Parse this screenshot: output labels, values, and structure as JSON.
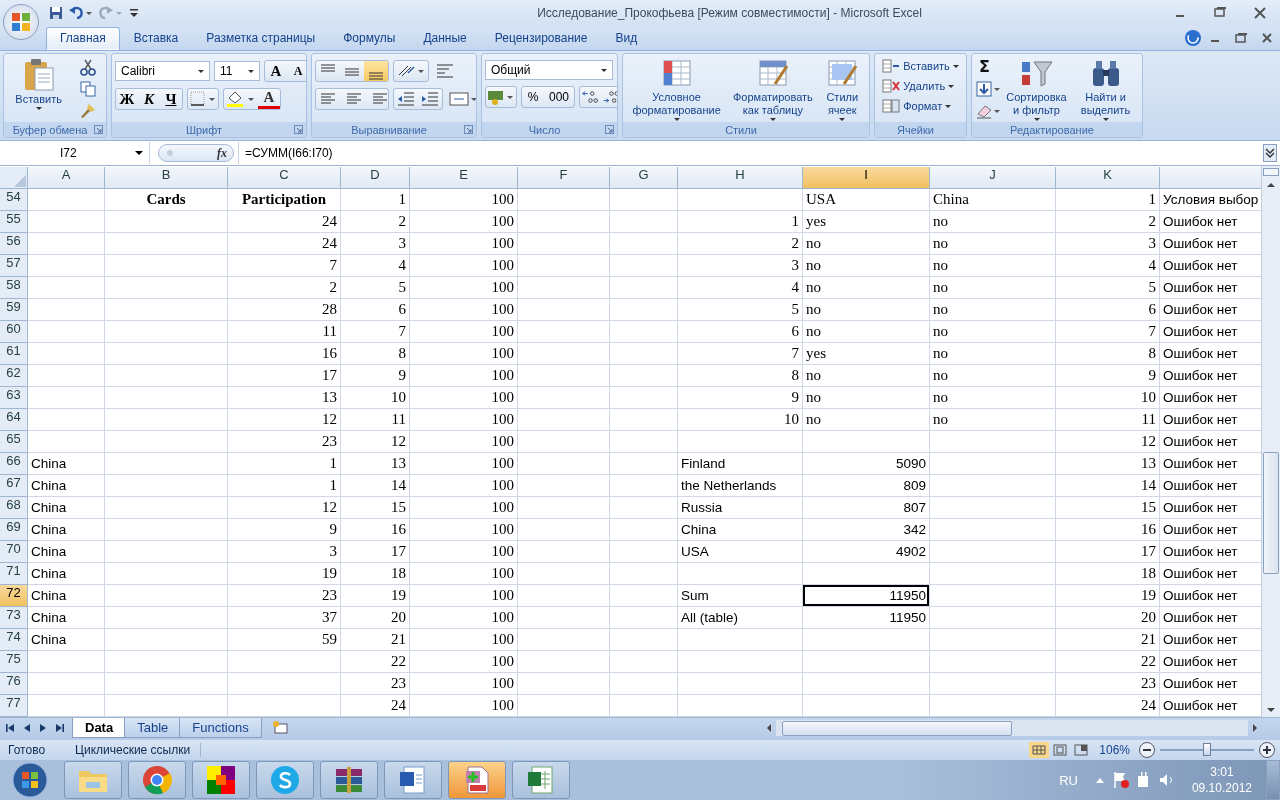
{
  "window": {
    "title": "Исследование_Прокофьева  [Режим совместимости] - Microsoft Excel"
  },
  "tabs": [
    {
      "label": "Главная",
      "selected": true
    },
    {
      "label": "Вставка",
      "selected": false
    },
    {
      "label": "Разметка страницы",
      "selected": false
    },
    {
      "label": "Формулы",
      "selected": false
    },
    {
      "label": "Данные",
      "selected": false
    },
    {
      "label": "Рецензирование",
      "selected": false
    },
    {
      "label": "Вид",
      "selected": false
    }
  ],
  "ribbon": {
    "groups": [
      {
        "kind": "clipboard",
        "label": "Буфер обмена",
        "paste": "Вставить"
      },
      {
        "kind": "font",
        "label": "Шрифт",
        "font": "Calibri",
        "size": "11",
        "grow": "A",
        "shrink": "A",
        "bold": "Ж",
        "italic": "К",
        "underline": "Ч",
        "color_letter": "A"
      },
      {
        "kind": "alignment",
        "label": "Выравнивание",
        "valign": [
          {
            "selected": false
          },
          {
            "selected": false
          },
          {
            "selected": true
          }
        ]
      },
      {
        "kind": "number",
        "label": "Число",
        "format": "Общий",
        "percent": "%",
        "thousands": "000"
      },
      {
        "kind": "styles",
        "label": "Стили",
        "buttons": [
          "Условное форматирование",
          "Форматировать как таблицу",
          "Стили ячеек"
        ]
      },
      {
        "kind": "cells",
        "label": "Ячейки",
        "buttons": [
          "Вставить",
          "Удалить",
          "Формат"
        ]
      },
      {
        "kind": "editing",
        "label": "Редактирование",
        "sum": "Σ",
        "buttons": [
          "Сортировка и фильтр",
          "Найти и выделить"
        ]
      }
    ]
  },
  "formula_bar": {
    "name_box": "I72",
    "fx": "fx",
    "formula": "=СУММ(I66:I70)"
  },
  "columns": [
    {
      "label": "A",
      "selected": false
    },
    {
      "label": "B",
      "selected": false
    },
    {
      "label": "C",
      "selected": false
    },
    {
      "label": "D",
      "selected": false
    },
    {
      "label": "E",
      "selected": false
    },
    {
      "label": "F",
      "selected": false
    },
    {
      "label": "G",
      "selected": false
    },
    {
      "label": "H",
      "selected": false
    },
    {
      "label": "I",
      "selected": true
    },
    {
      "label": "J",
      "selected": false
    },
    {
      "label": "K",
      "selected": false
    }
  ],
  "rows": [
    {
      "num": "54",
      "selected": false,
      "cells": [
        "",
        {
          "text": "Cards",
          "bold": true
        },
        {
          "text": "Participation",
          "bold": true
        },
        "1",
        "100",
        "",
        "",
        "",
        "USA",
        "China",
        "1",
        "Условия выбор"
      ]
    },
    {
      "num": "55",
      "selected": false,
      "cells": [
        "",
        "",
        "24",
        "2",
        "100",
        "",
        "",
        "1",
        "yes",
        "no",
        "2",
        "Ошибок нет"
      ]
    },
    {
      "num": "56",
      "selected": false,
      "cells": [
        "",
        "",
        "24",
        "3",
        "100",
        "",
        "",
        "2",
        "no",
        "no",
        "3",
        "Ошибок нет"
      ]
    },
    {
      "num": "57",
      "selected": false,
      "cells": [
        "",
        "",
        "7",
        "4",
        "100",
        "",
        "",
        "3",
        "no",
        "no",
        "4",
        "Ошибок нет"
      ]
    },
    {
      "num": "58",
      "selected": false,
      "cells": [
        "",
        "",
        "2",
        "5",
        "100",
        "",
        "",
        "4",
        "no",
        "no",
        "5",
        "Ошибок нет"
      ]
    },
    {
      "num": "59",
      "selected": false,
      "cells": [
        "",
        "",
        "28",
        "6",
        "100",
        "",
        "",
        "5",
        "no",
        "no",
        "6",
        "Ошибок нет"
      ]
    },
    {
      "num": "60",
      "selected": false,
      "cells": [
        "",
        "",
        "11",
        "7",
        "100",
        "",
        "",
        "6",
        "no",
        "no",
        "7",
        "Ошибок нет"
      ]
    },
    {
      "num": "61",
      "selected": false,
      "cells": [
        "",
        "",
        "16",
        "8",
        "100",
        "",
        "",
        "7",
        "yes",
        "no",
        "8",
        "Ошибок нет"
      ]
    },
    {
      "num": "62",
      "selected": false,
      "cells": [
        "",
        "",
        "17",
        "9",
        "100",
        "",
        "",
        "8",
        "no",
        "no",
        "9",
        "Ошибок нет"
      ]
    },
    {
      "num": "63",
      "selected": false,
      "cells": [
        "",
        "",
        "13",
        "10",
        "100",
        "",
        "",
        "9",
        "no",
        "no",
        "10",
        "Ошибок нет"
      ]
    },
    {
      "num": "64",
      "selected": false,
      "cells": [
        "",
        "",
        "12",
        "11",
        "100",
        "",
        "",
        "10",
        "no",
        "no",
        "11",
        "Ошибок нет"
      ]
    },
    {
      "num": "65",
      "selected": false,
      "cells": [
        "",
        "",
        "23",
        "12",
        "100",
        "",
        "",
        "",
        "",
        "",
        "12",
        "Ошибок нет"
      ]
    },
    {
      "num": "66",
      "selected": false,
      "cells": [
        "China",
        "",
        "1",
        "13",
        "100",
        "",
        "",
        "Finland",
        "5090",
        "",
        "13",
        "Ошибок нет"
      ]
    },
    {
      "num": "67",
      "selected": false,
      "cells": [
        "China",
        "",
        "1",
        "14",
        "100",
        "",
        "",
        "the Netherlands",
        "809",
        "",
        "14",
        "Ошибок нет"
      ]
    },
    {
      "num": "68",
      "selected": false,
      "cells": [
        "China",
        "",
        "12",
        "15",
        "100",
        "",
        "",
        "Russia",
        "807",
        "",
        "15",
        "Ошибок нет"
      ]
    },
    {
      "num": "69",
      "selected": false,
      "cells": [
        "China",
        "",
        "9",
        "16",
        "100",
        "",
        "",
        "China",
        "342",
        "",
        "16",
        "Ошибок нет"
      ]
    },
    {
      "num": "70",
      "selected": false,
      "cells": [
        "China",
        "",
        "3",
        "17",
        "100",
        "",
        "",
        "USA",
        "4902",
        "",
        "17",
        "Ошибок нет"
      ]
    },
    {
      "num": "71",
      "selected": false,
      "cells": [
        "China",
        "",
        "19",
        "18",
        "100",
        "",
        "",
        "",
        "",
        "",
        "18",
        "Ошибок нет"
      ]
    },
    {
      "num": "72",
      "selected": true,
      "cells": [
        "China",
        "",
        "23",
        "19",
        "100",
        "",
        "",
        "Sum",
        "11950",
        "",
        "19",
        "Ошибок нет"
      ]
    },
    {
      "num": "73",
      "selected": false,
      "cells": [
        "China",
        "",
        "37",
        "20",
        "100",
        "",
        "",
        "All (table)",
        "11950",
        "",
        "20",
        "Ошибок нет"
      ]
    },
    {
      "num": "74",
      "selected": false,
      "cells": [
        "China",
        "",
        "59",
        "21",
        "100",
        "",
        "",
        "",
        "",
        "",
        "21",
        "Ошибок нет"
      ]
    },
    {
      "num": "75",
      "selected": false,
      "cells": [
        "",
        "",
        "",
        "22",
        "100",
        "",
        "",
        "",
        "",
        "",
        "22",
        "Ошибок нет"
      ]
    },
    {
      "num": "76",
      "selected": false,
      "cells": [
        "",
        "",
        "",
        "23",
        "100",
        "",
        "",
        "",
        "",
        "",
        "23",
        "Ошибок нет"
      ]
    },
    {
      "num": "77",
      "selected": false,
      "cells": [
        "",
        "",
        "",
        "24",
        "100",
        "",
        "",
        "",
        "",
        "",
        "24",
        "Ошибок нет"
      ]
    }
  ],
  "sheet_tabs": [
    {
      "label": "Data",
      "selected": true
    },
    {
      "label": "Table",
      "selected": false
    },
    {
      "label": "Functions",
      "selected": false
    }
  ],
  "status_bar": {
    "ready": "Готово",
    "circular": "Циклические ссылки",
    "zoom": "106%",
    "zoom_slider": {
      "level": 0.5
    }
  },
  "taskbar": {
    "apps": [
      {
        "kind": "folder",
        "selected": false
      },
      {
        "kind": "chrome",
        "selected": false
      },
      {
        "kind": "squares",
        "selected": false
      },
      {
        "kind": "skype",
        "selected": false
      },
      {
        "kind": "archive",
        "selected": false
      },
      {
        "kind": "word",
        "selected": false
      },
      {
        "kind": "spss",
        "selected": true
      },
      {
        "kind": "excel",
        "selected": false
      }
    ],
    "language": "RU",
    "time": "3:01",
    "date": "09.10.2012"
  }
}
